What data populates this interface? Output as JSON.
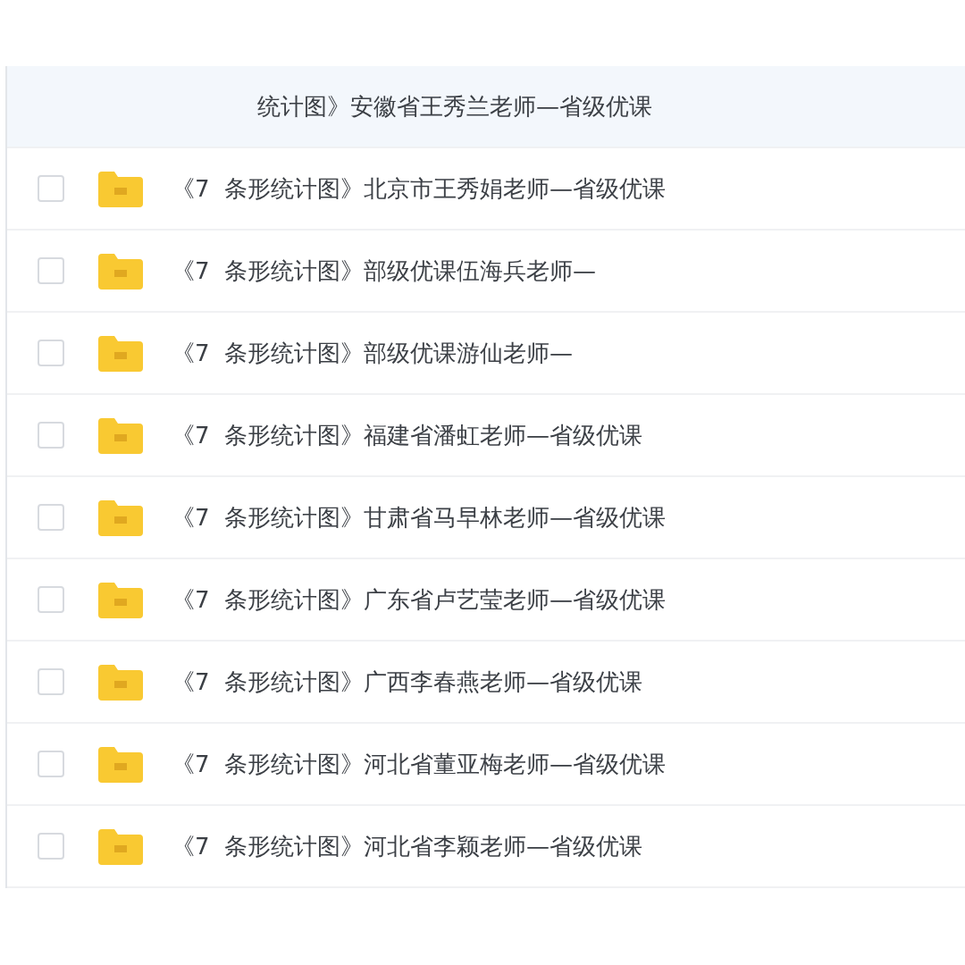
{
  "files": [
    {
      "kind": "covered",
      "name": "统计图》安徽省王秀兰老师—省级优课",
      "hovered": true
    },
    {
      "kind": "folder",
      "name": "《7  条形统计图》北京市王秀娟老师—省级优课",
      "hovered": false,
      "checked": false
    },
    {
      "kind": "folder",
      "name": "《7  条形统计图》部级优课伍海兵老师—",
      "hovered": false,
      "checked": false
    },
    {
      "kind": "folder",
      "name": "《7  条形统计图》部级优课游仙老师—",
      "hovered": false,
      "checked": false
    },
    {
      "kind": "folder",
      "name": "《7  条形统计图》福建省潘虹老师—省级优课",
      "hovered": false,
      "checked": false
    },
    {
      "kind": "folder",
      "name": "《7  条形统计图》甘肃省马早林老师—省级优课",
      "hovered": false,
      "checked": false
    },
    {
      "kind": "folder",
      "name": "《7  条形统计图》广东省卢艺莹老师—省级优课",
      "hovered": false,
      "checked": false
    },
    {
      "kind": "folder",
      "name": "《7  条形统计图》广西李春燕老师—省级优课",
      "hovered": false,
      "checked": false
    },
    {
      "kind": "folder",
      "name": "《7  条形统计图》河北省董亚梅老师—省级优课",
      "hovered": false,
      "checked": false
    },
    {
      "kind": "folder",
      "name": "《7  条形统计图》河北省李颖老师—省级优课",
      "hovered": false,
      "checked": false
    }
  ]
}
